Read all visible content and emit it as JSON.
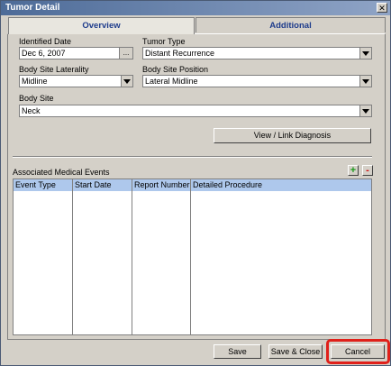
{
  "window": {
    "title": "Tumor Detail",
    "close_glyph": "✕"
  },
  "tabs": [
    {
      "label": "Overview"
    },
    {
      "label": "Additional"
    }
  ],
  "form": {
    "identified_date": {
      "label": "Identified Date",
      "value": "Dec 6, 2007",
      "picker_glyph": "..."
    },
    "tumor_type": {
      "label": "Tumor Type",
      "value": "Distant Recurrence"
    },
    "body_site_laterality": {
      "label": "Body Site Laterality",
      "value": "Midline"
    },
    "body_site_position": {
      "label": "Body Site Position",
      "value": "Lateral Midline"
    },
    "body_site": {
      "label": "Body Site",
      "value": "Neck"
    }
  },
  "view_link_label": "View / Link Diagnosis",
  "events": {
    "title": "Associated Medical Events",
    "add_glyph": "+",
    "remove_glyph": "-",
    "columns": [
      "Event Type",
      "Start Date",
      "Report Number",
      "Detailed Procedure"
    ]
  },
  "footer": {
    "save_label": "Save",
    "save_close_label": "Save & Close",
    "cancel_label": "Cancel"
  },
  "colors": {
    "highlight": "#e0201a",
    "grid_header": "#aec8ec",
    "tab_text": "#1e3c8c"
  }
}
